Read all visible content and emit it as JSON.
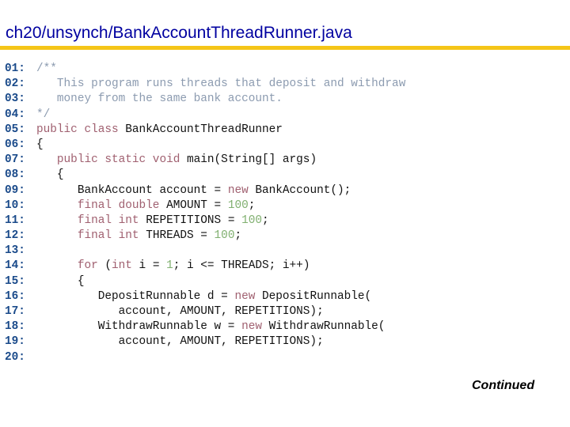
{
  "header": {
    "title": "ch20/unsynch/BankAccountThreadRunner.java",
    "title_color": "#0000a0",
    "rule_color": "#f5c518"
  },
  "code": {
    "lines": [
      {
        "num": "01:",
        "tokens": [
          {
            "t": "comment",
            "v": "/**"
          }
        ]
      },
      {
        "num": "02:",
        "tokens": [
          {
            "t": "comment",
            "v": "   This program runs threads that deposit and withdraw"
          }
        ]
      },
      {
        "num": "03:",
        "tokens": [
          {
            "t": "comment",
            "v": "   money from the same bank account."
          }
        ]
      },
      {
        "num": "04:",
        "tokens": [
          {
            "t": "comment",
            "v": "*/"
          }
        ]
      },
      {
        "num": "05:",
        "tokens": [
          {
            "t": "keyword",
            "v": "public class "
          },
          {
            "t": "plain",
            "v": "BankAccountThreadRunner"
          }
        ]
      },
      {
        "num": "06:",
        "tokens": [
          {
            "t": "plain",
            "v": "{"
          }
        ]
      },
      {
        "num": "07:",
        "tokens": [
          {
            "t": "keyword",
            "v": "   public static void "
          },
          {
            "t": "plain",
            "v": "main(String[] args)"
          }
        ]
      },
      {
        "num": "08:",
        "tokens": [
          {
            "t": "plain",
            "v": "   {"
          }
        ]
      },
      {
        "num": "09:",
        "tokens": [
          {
            "t": "plain",
            "v": "      BankAccount account = "
          },
          {
            "t": "keyword",
            "v": "new "
          },
          {
            "t": "plain",
            "v": "BankAccount();"
          }
        ]
      },
      {
        "num": "10:",
        "tokens": [
          {
            "t": "keyword",
            "v": "      final double "
          },
          {
            "t": "plain",
            "v": "AMOUNT = "
          },
          {
            "t": "number",
            "v": "100"
          },
          {
            "t": "plain",
            "v": ";"
          }
        ]
      },
      {
        "num": "11:",
        "tokens": [
          {
            "t": "keyword",
            "v": "      final int "
          },
          {
            "t": "plain",
            "v": "REPETITIONS = "
          },
          {
            "t": "number",
            "v": "100"
          },
          {
            "t": "plain",
            "v": ";"
          }
        ]
      },
      {
        "num": "12:",
        "tokens": [
          {
            "t": "keyword",
            "v": "      final int "
          },
          {
            "t": "plain",
            "v": "THREADS = "
          },
          {
            "t": "number",
            "v": "100"
          },
          {
            "t": "plain",
            "v": ";"
          }
        ]
      },
      {
        "num": "13:",
        "tokens": []
      },
      {
        "num": "14:",
        "tokens": [
          {
            "t": "keyword",
            "v": "      for "
          },
          {
            "t": "plain",
            "v": "("
          },
          {
            "t": "keyword",
            "v": "int "
          },
          {
            "t": "plain",
            "v": "i = "
          },
          {
            "t": "number",
            "v": "1"
          },
          {
            "t": "plain",
            "v": "; i <= THREADS; i++)"
          }
        ]
      },
      {
        "num": "15:",
        "tokens": [
          {
            "t": "plain",
            "v": "      {"
          }
        ]
      },
      {
        "num": "16:",
        "tokens": [
          {
            "t": "plain",
            "v": "         DepositRunnable d = "
          },
          {
            "t": "keyword",
            "v": "new "
          },
          {
            "t": "plain",
            "v": "DepositRunnable("
          }
        ]
      },
      {
        "num": "17:",
        "tokens": [
          {
            "t": "plain",
            "v": "            account, AMOUNT, REPETITIONS);"
          }
        ]
      },
      {
        "num": "18:",
        "tokens": [
          {
            "t": "plain",
            "v": "         WithdrawRunnable w = "
          },
          {
            "t": "keyword",
            "v": "new "
          },
          {
            "t": "plain",
            "v": "WithdrawRunnable("
          }
        ]
      },
      {
        "num": "19:",
        "tokens": [
          {
            "t": "plain",
            "v": "            account, AMOUNT, REPETITIONS);"
          }
        ]
      },
      {
        "num": "20:",
        "tokens": []
      }
    ]
  },
  "footer": {
    "continued_label": "Continued"
  }
}
